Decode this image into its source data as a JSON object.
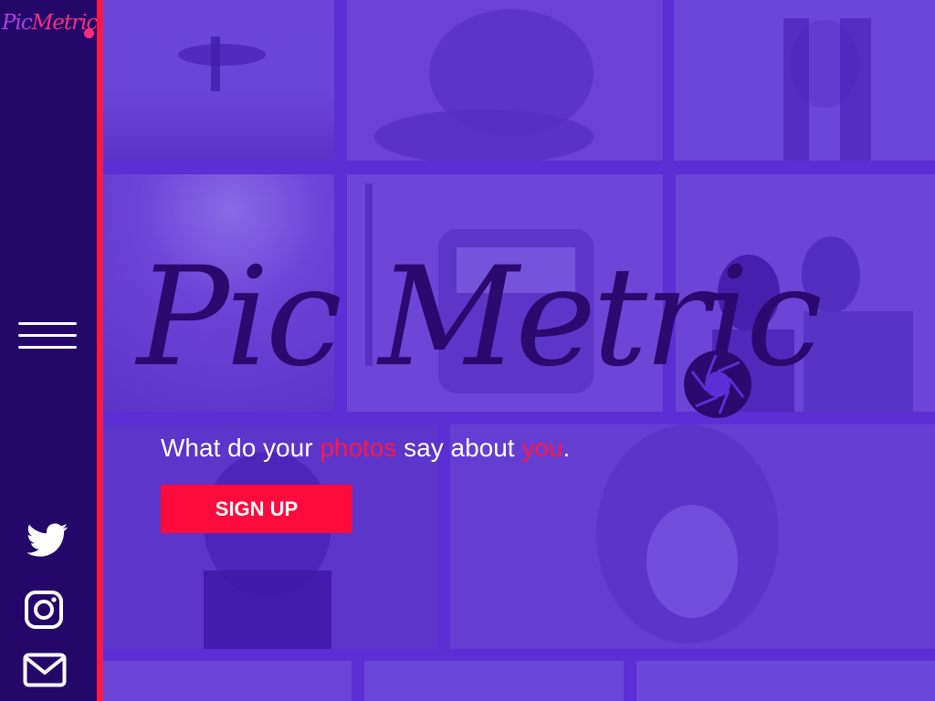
{
  "brand": {
    "logo_word1": "Pic",
    "logo_word2": "Metric",
    "hero_word1": "Pic",
    "hero_word2": "Metric"
  },
  "tagline": {
    "part1": "What do your ",
    "highlight1": "photos",
    "part2": " say about ",
    "highlight2": "you",
    "part3": "."
  },
  "cta": {
    "signup_label": "SIGN UP"
  },
  "sidebar": {
    "menu_icon": "hamburger-menu-icon",
    "social": [
      {
        "icon": "twitter-icon"
      },
      {
        "icon": "instagram-icon"
      },
      {
        "icon": "mail-icon"
      }
    ]
  },
  "colors": {
    "sidebar_bg": "#23086a",
    "accent": "#ff1744",
    "photo_overlay": "#5b2ed6",
    "hero_text": "#2a0a6e",
    "logo_purple": "#b33ee0",
    "logo_pink": "#ff2d80"
  }
}
